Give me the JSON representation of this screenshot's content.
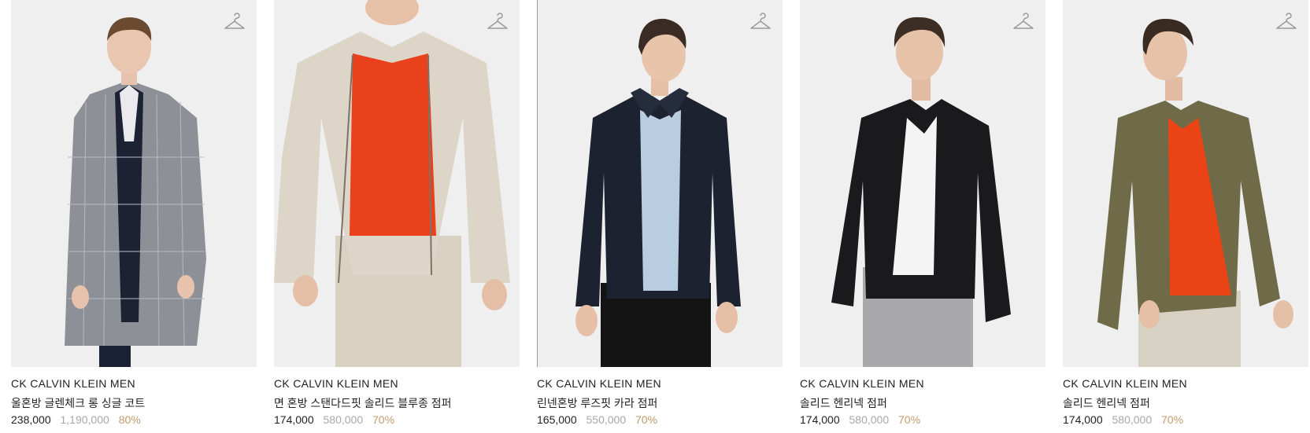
{
  "products": [
    {
      "brand": "CK CALVIN KLEIN MEN",
      "name": "울혼방 글렌체크 롱 싱글 코트",
      "price": "238,000",
      "original_price": "1,190,000",
      "discount": "80%",
      "wishlist_icon": "hanger-icon",
      "garment_color": "#8d9096",
      "inner_color": "#1c2233",
      "pants_color": "#1a2135"
    },
    {
      "brand": "CK CALVIN KLEIN MEN",
      "name": "면 혼방 스탠다드핏 솔리드 블루종 점퍼",
      "price": "174,000",
      "original_price": "580,000",
      "discount": "70%",
      "wishlist_icon": "hanger-icon",
      "garment_color": "#ddd6c8",
      "inner_color": "#e8411c",
      "pants_color": "#d9d2c2"
    },
    {
      "brand": "CK CALVIN KLEIN MEN",
      "name": "린넨혼방 루즈핏 카라 점퍼",
      "price": "165,000",
      "original_price": "550,000",
      "discount": "70%",
      "wishlist_icon": "hanger-icon",
      "garment_color": "#1c2230",
      "inner_color": "#b9cde0",
      "pants_color": "#141414"
    },
    {
      "brand": "CK CALVIN KLEIN MEN",
      "name": "솔리드 헨리넥 점퍼",
      "price": "174,000",
      "original_price": "580,000",
      "discount": "70%",
      "wishlist_icon": "hanger-icon",
      "garment_color": "#1a1a1c",
      "inner_color": "#f4f4f4",
      "pants_color": "#a9a9ab"
    },
    {
      "brand": "CK CALVIN KLEIN MEN",
      "name": "솔리드 헨리넥 점퍼",
      "price": "174,000",
      "original_price": "580,000",
      "discount": "70%",
      "wishlist_icon": "hanger-icon",
      "garment_color": "#6f6a48",
      "inner_color": "#ea4416",
      "pants_color": "#d8d2c4"
    }
  ],
  "colors": {
    "discount": "#c49a6c",
    "original_price": "#a8a8a8",
    "photo_background": "#efefef"
  }
}
